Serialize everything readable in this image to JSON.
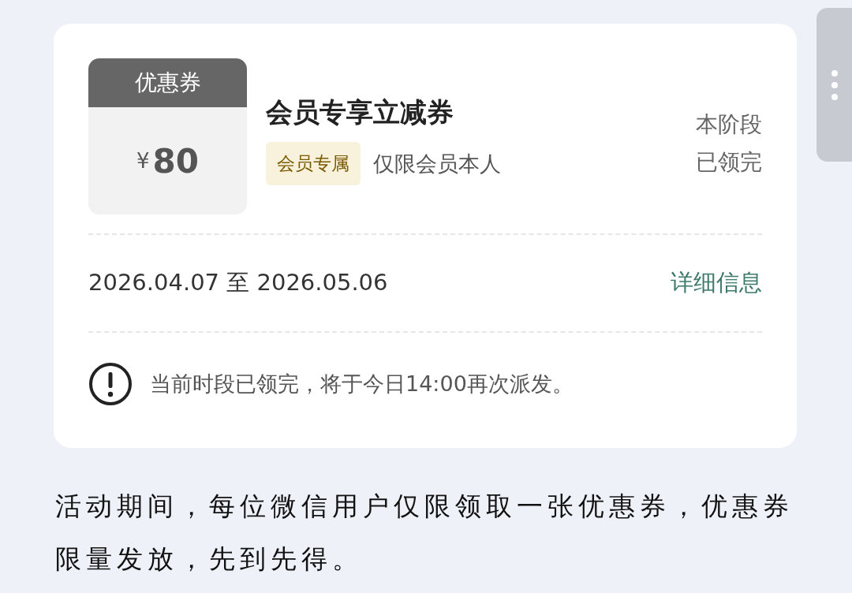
{
  "coupon_card": {
    "stub": {
      "label": "优惠券",
      "currency": "¥",
      "amount": "80"
    },
    "title": "会员专享立减券",
    "tag": "会员专属",
    "restriction": "仅限会员本人",
    "status_lines": [
      "本阶段",
      "已领完"
    ],
    "validity": "2026.04.07 至 2026.05.06",
    "details_link": "详细信息",
    "notice": "当前时段已领完，将于今日14:00再次派发。"
  },
  "description": "活动期间，每位微信用户仅限领取一张优惠券，优惠券限量发放，先到先得。"
}
